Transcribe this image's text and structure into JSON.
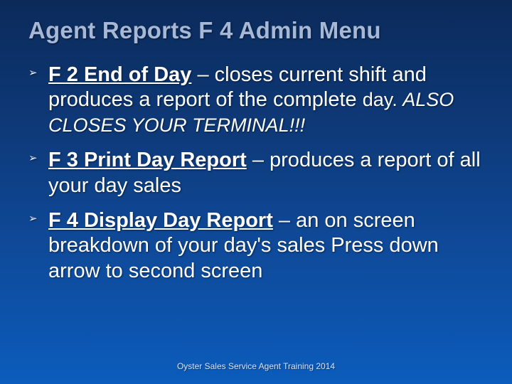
{
  "title": "Agent Reports F 4 Admin Menu",
  "bullets": [
    {
      "heading": "F 2 End of Day",
      "tail1": " – closes current shift and produces a report of the complete ",
      "small": "day. ",
      "italic": "ALSO CLOSES YOUR TERMINAL!!!"
    },
    {
      "heading": "F 3 Print Day Report",
      "tail1": " – produces a report of all your day sales"
    },
    {
      "heading": "F 4 Display Day Report",
      "tail1": " – an on screen breakdown of your day's sales Press down arrow to second screen"
    }
  ],
  "footer": "Oyster Sales Service Agent Training 2014"
}
